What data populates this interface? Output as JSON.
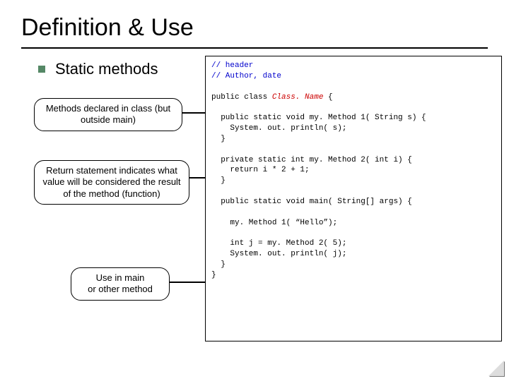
{
  "title": "Definition & Use",
  "bullet": "Static methods",
  "callout1": "Methods declared in class (but outside main)",
  "callout2": "Return statement indicates what value will be considered the result of the method (function)",
  "callout3": "Use in main\nor other method",
  "code": {
    "l1a": "// header",
    "l1b": "// Author, date",
    "l2a": "public class ",
    "l2b": "Class. Name",
    "l2c": " {",
    "l3": "  public static void my. Method 1( String s) {",
    "l4": "    System. out. println( s);",
    "l5": "  }",
    "l6": "  private static int my. Method 2( int i) {",
    "l7": "    return i * 2 + 1;",
    "l8": "  }",
    "l9": "  public static void main( String[] args) {",
    "l10": "    my. Method 1( “Hello”);",
    "l11": "    int j = my. Method 2( 5);",
    "l12": "    System. out. println( j);",
    "l13": "  }",
    "l14": "}"
  }
}
